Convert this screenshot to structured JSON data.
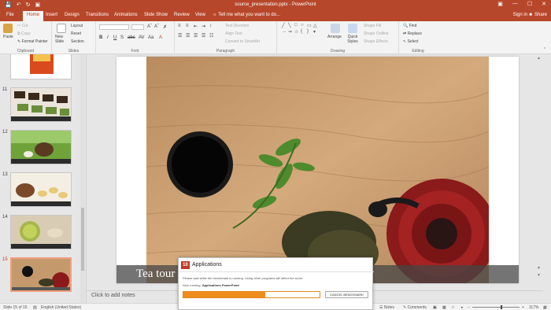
{
  "window": {
    "title": "source_presentation.pptx - PowerPoint",
    "quick_access": [
      "save-icon",
      "undo-icon",
      "redo-icon",
      "present-icon"
    ],
    "controls": [
      "restore-ribbon-icon",
      "minimize-icon",
      "maximize-icon",
      "close-icon"
    ]
  },
  "tabs": [
    "File",
    "Home",
    "Insert",
    "Design",
    "Transitions",
    "Animations",
    "Slide Show",
    "Review",
    "View"
  ],
  "active_tab": "Home",
  "tell_me": "Tell me what you want to do...",
  "sign_in": "Sign in",
  "share": "Share",
  "ribbon": {
    "clipboard": {
      "paste": "Paste",
      "cut": "Cut",
      "copy": "Copy",
      "format_painter": "Format Painter",
      "label": "Clipboard"
    },
    "slides": {
      "new_slide": "New Slide",
      "layout": "Layout",
      "reset": "Reset",
      "section": "Section",
      "label": "Slides"
    },
    "font": {
      "label": "Font",
      "buttons": [
        "B",
        "I",
        "U",
        "S",
        "abc",
        "AV",
        "Aa",
        "A"
      ]
    },
    "paragraph": {
      "label": "Paragraph",
      "text_direction": "Text Direction",
      "align_text": "Align Text",
      "convert_smartart": "Convert to SmartArt"
    },
    "drawing": {
      "label": "Drawing",
      "arrange": "Arrange",
      "quick_styles": "Quick Styles",
      "shape_fill": "Shape Fill",
      "shape_outline": "Shape Outline",
      "shape_effects": "Shape Effects"
    },
    "editing": {
      "label": "Editing",
      "find": "Find",
      "replace": "Replace",
      "select": "Select"
    }
  },
  "thumbnails": [
    {
      "num": "",
      "scene": "noodles"
    },
    {
      "num": "11",
      "scene": "cups"
    },
    {
      "num": "12",
      "scene": "teapot-green"
    },
    {
      "num": "13",
      "scene": "teaset"
    },
    {
      "num": "14",
      "scene": "matcha"
    },
    {
      "num": "15",
      "scene": "selected"
    }
  ],
  "slide": {
    "caption": "Tea tour"
  },
  "notes_placeholder": "Click to add notes",
  "status": {
    "slide_of": "Slide 15 of 15",
    "language": "English (United States)",
    "notes": "Notes",
    "comments": "Comments",
    "zoom": "117%"
  },
  "dialog": {
    "title": "Applications",
    "message": "Please wait while the benchmark is running. Using other programs will affect the score.",
    "now_running_label": "Now running:",
    "now_running_value": "Applications PowerPoint",
    "progress": 0.6,
    "cancel": "CANCEL BENCHMARK"
  },
  "colors": {
    "accent": "#b7472a",
    "progress": "#f08c1c"
  }
}
